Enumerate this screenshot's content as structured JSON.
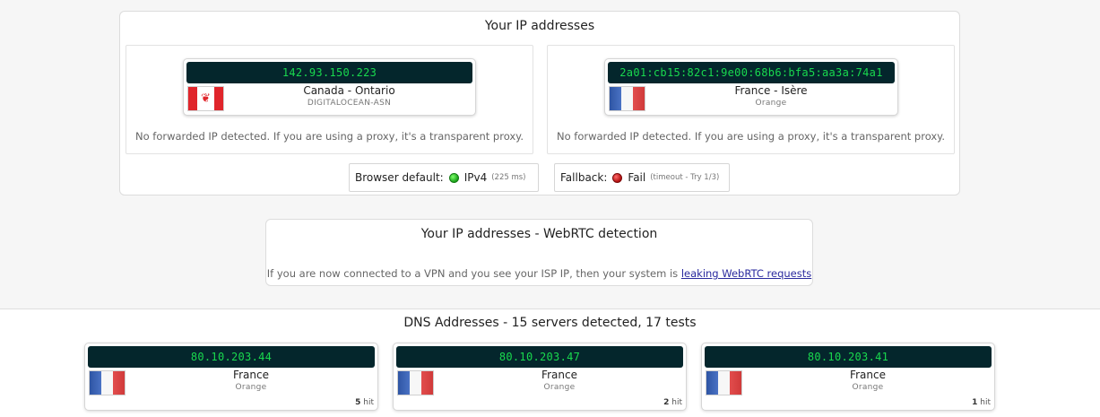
{
  "ip_panel": {
    "title": "Your IP addresses",
    "ipv4": {
      "ip": "142.93.150.223",
      "location": "Canada - Ontario",
      "isp": "DIGITALOCEAN-ASN",
      "flag": "canada-flag",
      "note": "No forwarded IP detected. If you are using a proxy, it's a transparent proxy."
    },
    "ipv6": {
      "ip": "2a01:cb15:82c1:9e00:68b6:bfa5:aa3a:74a1",
      "location": "France - Isère",
      "isp": "Orange",
      "flag": "france-flag",
      "note": "No forwarded IP detected. If you are using a proxy, it's a transparent proxy."
    },
    "browser_default": {
      "label": "Browser default:",
      "status": "green",
      "value": "IPv4",
      "detail": "(225 ms)"
    },
    "fallback": {
      "label": "Fallback:",
      "status": "red",
      "value": "Fail",
      "detail": "(timeout - Try 1/3)"
    }
  },
  "webrtc": {
    "title": "Your IP addresses - WebRTC detection",
    "note": "If you are now connected to a VPN and you see your ISP IP, then your system is ",
    "link": "leaking WebRTC requests"
  },
  "dns": {
    "title": "DNS Addresses - 15 servers detected, 17 tests",
    "servers": [
      {
        "ip": "80.10.203.44",
        "country": "France",
        "isp": "Orange",
        "hits": "5",
        "hit_label": "hit"
      },
      {
        "ip": "80.10.203.47",
        "country": "France",
        "isp": "Orange",
        "hits": "2",
        "hit_label": "hit"
      },
      {
        "ip": "80.10.203.41",
        "country": "France",
        "isp": "Orange",
        "hits": "1",
        "hit_label": "hit"
      }
    ]
  },
  "colors": {
    "led_background": "#04262c",
    "led_text": "#19d94e",
    "status_green": "#18a018",
    "status_red": "#b10d0d",
    "link": "#2a2a9e"
  }
}
